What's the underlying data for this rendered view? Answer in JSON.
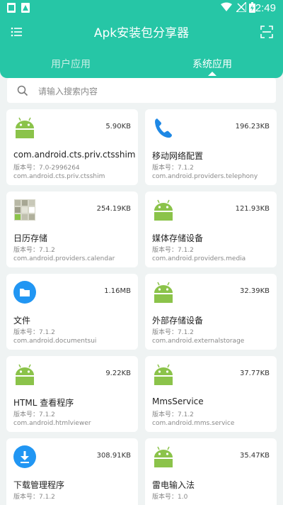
{
  "status_bar": {
    "time": "2:49"
  },
  "app_bar": {
    "title": "Apk安装包分享器",
    "menu_icon": "menu-icon",
    "scan_icon": "scan-icon"
  },
  "tabs": [
    {
      "label": "用户应用",
      "selected": false
    },
    {
      "label": "系统应用",
      "selected": true
    }
  ],
  "search": {
    "placeholder": "请输入搜索内容",
    "value": ""
  },
  "apps": [
    {
      "name": "com.android.cts.priv.ctsshim",
      "size": "5.90KB",
      "version": "版本号：7.0-2996264",
      "package": "com.android.cts.priv.ctsshim",
      "icon": "android-icon"
    },
    {
      "name": "移动网络配置",
      "size": "196.23KB",
      "version": "版本号：7.1.2",
      "package": "com.android.providers.telephony",
      "icon": "phone-icon"
    },
    {
      "name": "日历存储",
      "size": "254.19KB",
      "version": "版本号：7.1.2",
      "package": "com.android.providers.calendar",
      "icon": "calendar-icon"
    },
    {
      "name": "媒体存储设备",
      "size": "121.93KB",
      "version": "版本号：7.1.2",
      "package": "com.android.providers.media",
      "icon": "android-icon"
    },
    {
      "name": "文件",
      "size": "1.16MB",
      "version": "版本号：7.1.2",
      "package": "com.android.documentsui",
      "icon": "folder-icon"
    },
    {
      "name": "外部存储设备",
      "size": "32.39KB",
      "version": "版本号：7.1.2",
      "package": "com.android.externalstorage",
      "icon": "android-icon"
    },
    {
      "name": "HTML 查看程序",
      "size": "9.22KB",
      "version": "版本号：7.1.2",
      "package": "com.android.htmlviewer",
      "icon": "android-icon"
    },
    {
      "name": "MmsService",
      "size": "37.77KB",
      "version": "版本号：7.1.2",
      "package": "com.android.mms.service",
      "icon": "android-icon"
    },
    {
      "name": "下载管理程序",
      "size": "308.91KB",
      "version": "版本号：7.1.2",
      "package": "",
      "icon": "download-icon"
    },
    {
      "name": "雷电输入法",
      "size": "35.47KB",
      "version": "版本号：1.0",
      "package": "",
      "icon": "android-icon"
    }
  ],
  "colors": {
    "accent": "#26c6a6",
    "background": "#eff3f3",
    "android_green": "#8bc34a",
    "blue": "#2196f3"
  }
}
